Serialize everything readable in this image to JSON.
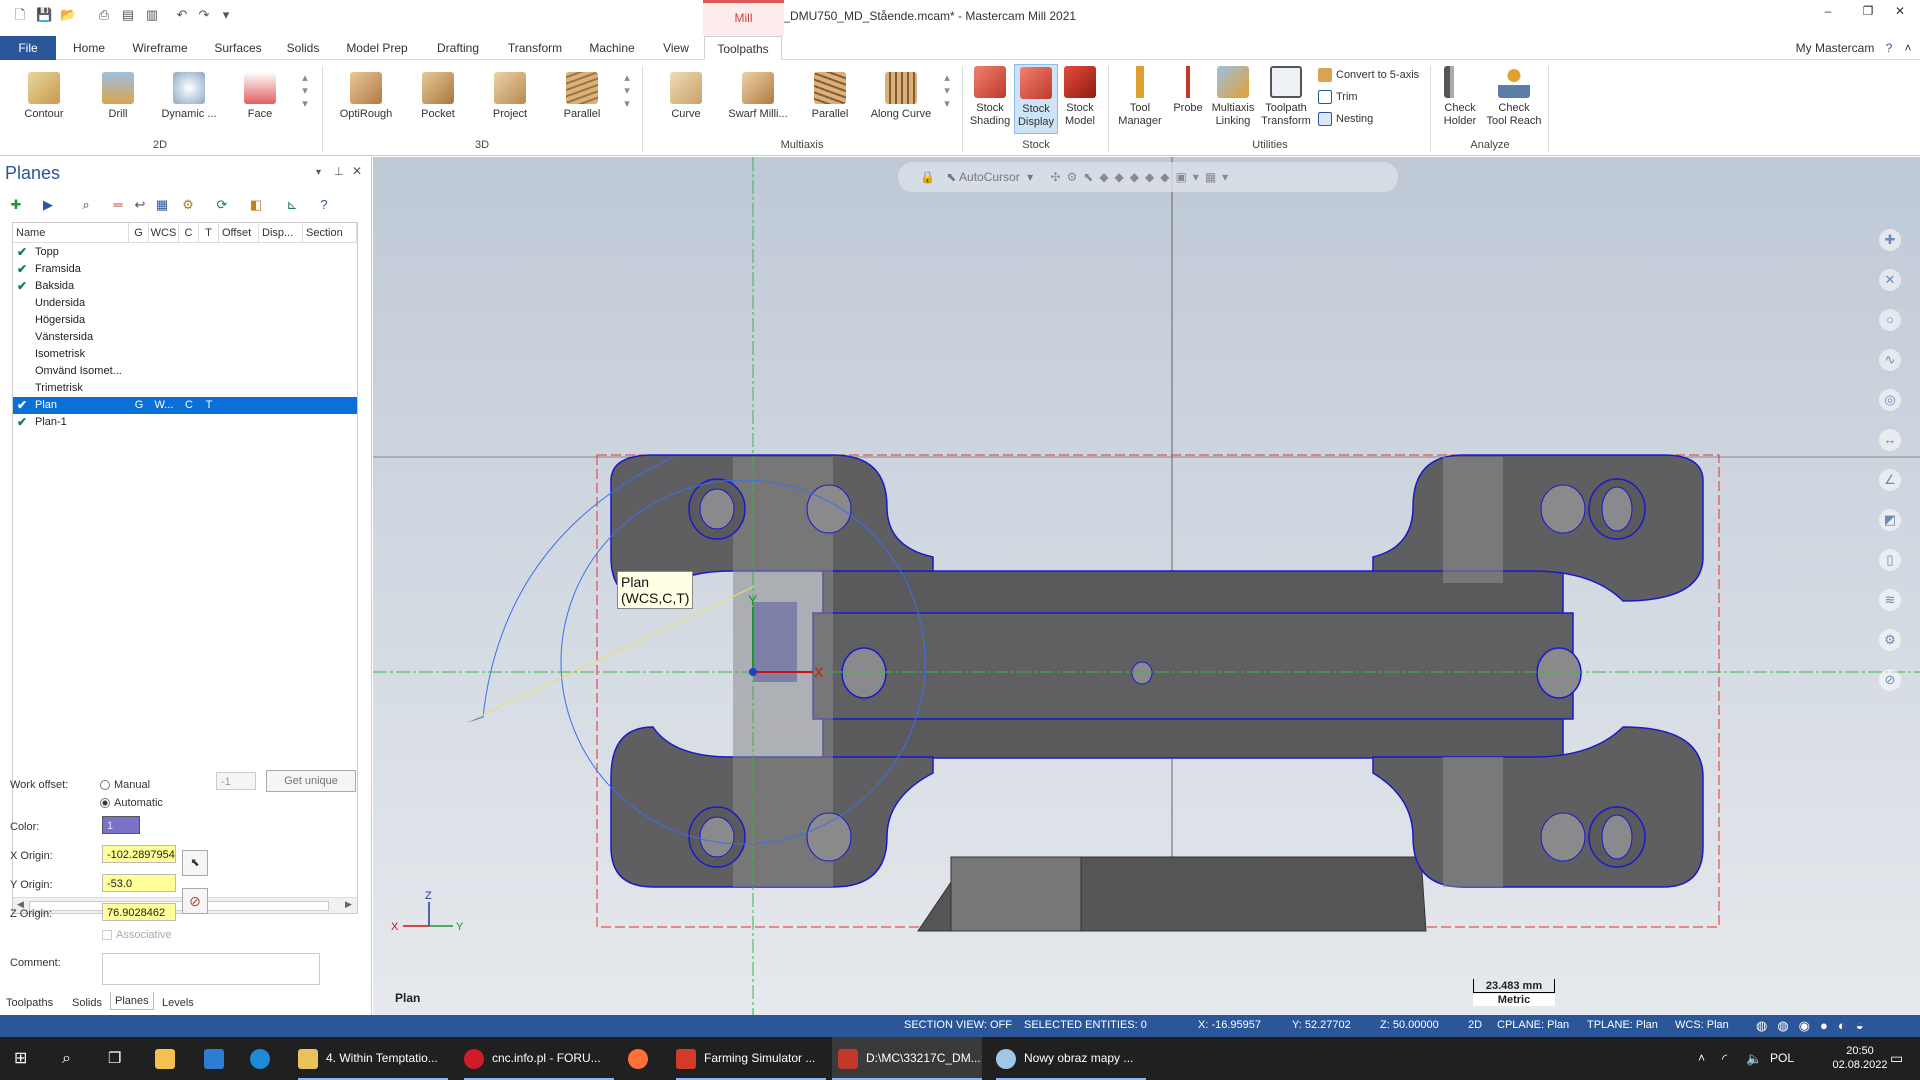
{
  "titlebar": {
    "doc_title": "D:\\MC\\33217C_DMU750_MD_Stående.mcam* - Mastercam Mill 2021",
    "context_tab": "Mill",
    "minimize": "–",
    "restore": "❐",
    "close": "✕"
  },
  "tabs": [
    "File",
    "Home",
    "Wireframe",
    "Surfaces",
    "Solids",
    "Model Prep",
    "Drafting",
    "Transform",
    "Machine",
    "View",
    "Toolpaths"
  ],
  "my_mastercam": "My Mastercam",
  "ribbon": {
    "g2d": {
      "label": "2D",
      "buttons": [
        "Contour",
        "Drill",
        "Dynamic ...",
        "Face"
      ]
    },
    "g3d": {
      "label": "3D",
      "buttons": [
        "OptiRough",
        "Pocket",
        "Project",
        "Parallel"
      ]
    },
    "gmulti": {
      "label": "Multiaxis",
      "buttons": [
        "Curve",
        "Swarf Milli...",
        "Parallel",
        "Along Curve"
      ]
    },
    "gstock": {
      "label": "Stock",
      "buttons": [
        "Stock\nShading",
        "Stock\nDisplay",
        "Stock\nModel"
      ]
    },
    "gutil": {
      "label": "Utilities",
      "buttons": [
        "Tool\nManager",
        "Probe",
        "Multiaxis\nLinking",
        "Toolpath\nTransform"
      ],
      "small": [
        "Convert to 5-axis",
        "Trim",
        "Nesting"
      ]
    },
    "ganalyze": {
      "label": "Analyze",
      "buttons": [
        "Check\nHolder",
        "Check\nTool Reach"
      ]
    }
  },
  "planes_panel": {
    "title": "Planes",
    "columns": [
      "Name",
      "G",
      "WCS",
      "C",
      "T",
      "Offset",
      "Disp...",
      "Section"
    ],
    "rows": [
      {
        "name": "Topp",
        "check": true
      },
      {
        "name": "Framsida",
        "check": true
      },
      {
        "name": "Baksida",
        "check": true
      },
      {
        "name": "Undersida",
        "check": false
      },
      {
        "name": "Högersida",
        "check": false
      },
      {
        "name": "Vänstersida",
        "check": false
      },
      {
        "name": "Isometrisk",
        "check": false
      },
      {
        "name": "Omvänd Isomet...",
        "check": false
      },
      {
        "name": "Trimetrisk",
        "check": false
      },
      {
        "name": "Plan",
        "check": true,
        "g": "G",
        "wcs": "W...",
        "c": "C",
        "t": "T",
        "selected": true
      },
      {
        "name": "Plan-1",
        "check": true
      }
    ],
    "work_offset_label": "Work offset:",
    "manual": "Manual",
    "automatic": "Automatic",
    "offset_value": "-1",
    "get_unique": "Get unique",
    "color_label": "Color:",
    "color_value": "1",
    "x_origin_label": "X Origin:",
    "x_origin": "-102.2897954",
    "y_origin_label": "Y Origin:",
    "y_origin": "-53.0",
    "z_origin_label": "Z Origin:",
    "z_origin": "76.9028462",
    "associative": "Associative",
    "comment_label": "Comment:",
    "bottom_tabs": [
      "Toolpaths",
      "Solids",
      "Planes",
      "Levels"
    ]
  },
  "viewport": {
    "autocursor": "AutoCursor",
    "tooltip_line1": "Plan",
    "tooltip_line2": "(WCS,C,T)",
    "view_name": "Plan",
    "scale_value": "23.483 mm",
    "scale_unit": "Metric",
    "axis_x": "X",
    "axis_y": "Y",
    "axis_z": "Z"
  },
  "status": {
    "section_view": "SECTION VIEW: OFF",
    "selected": "SELECTED ENTITIES: 0",
    "x": "X:   -16.95957",
    "y": "Y:   52.27702",
    "z": "Z:   50.00000",
    "mode": "2D",
    "cplane": "CPLANE: Plan",
    "tplane": "TPLANE: Plan",
    "wcs": "WCS: Plan"
  },
  "taskbar": {
    "items": [
      "4. Within Temptatio...",
      "cnc.info.pl - FORU...",
      "Farming Simulator ...",
      "D:\\MC\\33217C_DM...",
      "Nowy obraz mapy ..."
    ],
    "lang": "POL",
    "time": "20:50",
    "date": "02.08.2022"
  }
}
